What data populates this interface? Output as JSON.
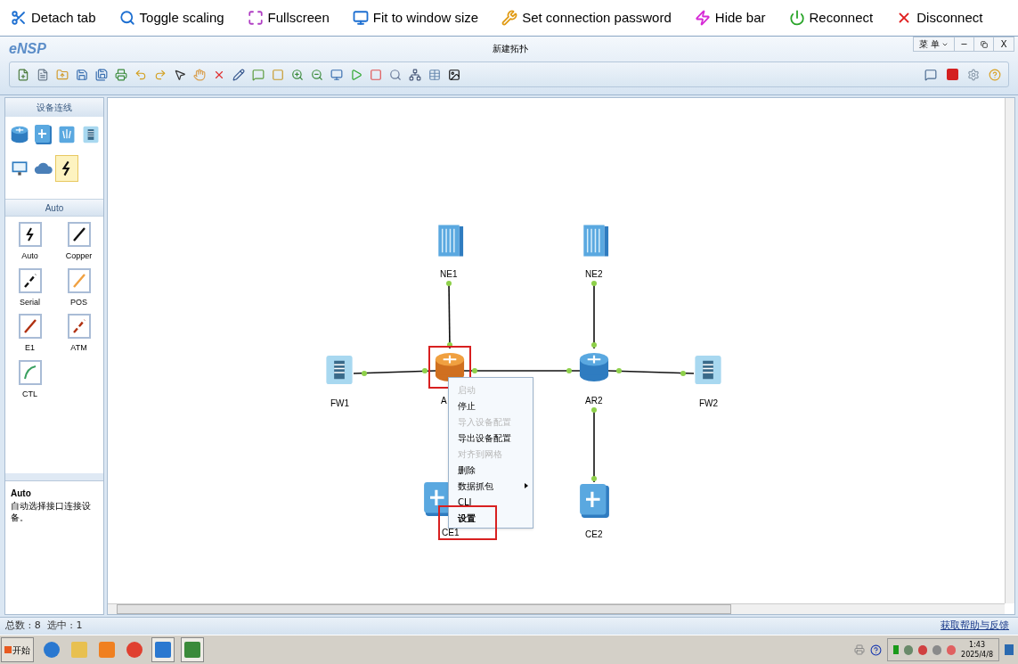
{
  "remote_bar": {
    "buttons": [
      {
        "kind": "detach",
        "label": "Detach tab"
      },
      {
        "kind": "scaling",
        "label": "Toggle scaling"
      },
      {
        "kind": "fullscreen",
        "label": "Fullscreen"
      },
      {
        "kind": "fit",
        "label": "Fit to window size"
      },
      {
        "kind": "password",
        "label": "Set connection password"
      },
      {
        "kind": "hide",
        "label": "Hide bar"
      },
      {
        "kind": "reconnect",
        "label": "Reconnect"
      },
      {
        "kind": "disconnect",
        "label": "Disconnect"
      }
    ]
  },
  "window": {
    "logo": "eNSP",
    "title": "新建拓扑",
    "menu_button": "菜 单",
    "close_button": "X"
  },
  "sidebar": {
    "title": "设备连线",
    "devices": [
      {
        "kind": "router",
        "selected": false
      },
      {
        "kind": "switch",
        "selected": false
      },
      {
        "kind": "wireless",
        "selected": false
      },
      {
        "kind": "firewall",
        "selected": false
      },
      {
        "kind": "pc",
        "selected": false
      },
      {
        "kind": "cloud",
        "selected": false
      },
      {
        "kind": "cable",
        "selected": true
      }
    ],
    "section_title": "Auto",
    "cables": [
      {
        "label": "Auto",
        "kind": "auto"
      },
      {
        "label": "Copper",
        "kind": "copper"
      },
      {
        "label": "Serial",
        "kind": "serial"
      },
      {
        "label": "POS",
        "kind": "pos"
      },
      {
        "label": "E1",
        "kind": "e1"
      },
      {
        "label": "ATM",
        "kind": "atm"
      },
      {
        "label": "CTL",
        "kind": "ctl"
      }
    ],
    "description_title": "Auto",
    "description": "自动选择接口连接设备。"
  },
  "canvas": {
    "nodes": [
      {
        "label": "NE1",
        "kind": "chassis",
        "selected": false,
        "highlighted": false
      },
      {
        "label": "NE2",
        "kind": "chassis",
        "selected": false,
        "highlighted": false
      },
      {
        "label": "FW1",
        "kind": "firewall",
        "selected": false,
        "highlighted": false
      },
      {
        "label": "A",
        "kind": "router",
        "selected": true,
        "highlighted": true
      },
      {
        "label": "AR2",
        "kind": "router",
        "selected": false,
        "highlighted": false
      },
      {
        "label": "FW2",
        "kind": "firewall",
        "selected": false,
        "highlighted": false
      },
      {
        "label": "CE1",
        "kind": "switch",
        "selected": false,
        "highlighted": false
      },
      {
        "label": "CE2",
        "kind": "switch",
        "selected": false,
        "highlighted": false
      }
    ],
    "context_menu": [
      {
        "label": "启动",
        "disabled": true,
        "submenu": false,
        "highlighted": false
      },
      {
        "label": "停止",
        "disabled": false,
        "submenu": false,
        "highlighted": false
      },
      {
        "label": "导入设备配置",
        "disabled": true,
        "submenu": false,
        "highlighted": false
      },
      {
        "label": "导出设备配置",
        "disabled": false,
        "submenu": false,
        "highlighted": false
      },
      {
        "label": "对齐到网格",
        "disabled": true,
        "submenu": false,
        "highlighted": false
      },
      {
        "label": "删除",
        "disabled": false,
        "submenu": false,
        "highlighted": false
      },
      {
        "label": "数据抓包",
        "disabled": false,
        "submenu": true,
        "highlighted": false
      },
      {
        "label": "CLI",
        "disabled": false,
        "submenu": false,
        "highlighted": false
      },
      {
        "label": "设置",
        "disabled": false,
        "submenu": false,
        "highlighted": true
      }
    ]
  },
  "status_bar": {
    "counts": "总数 : 8  选中 : 1",
    "help_link": "获取帮助与反馈"
  },
  "taskbar": {
    "start": "开始",
    "time": "1:43",
    "date": "2025/4/8"
  }
}
